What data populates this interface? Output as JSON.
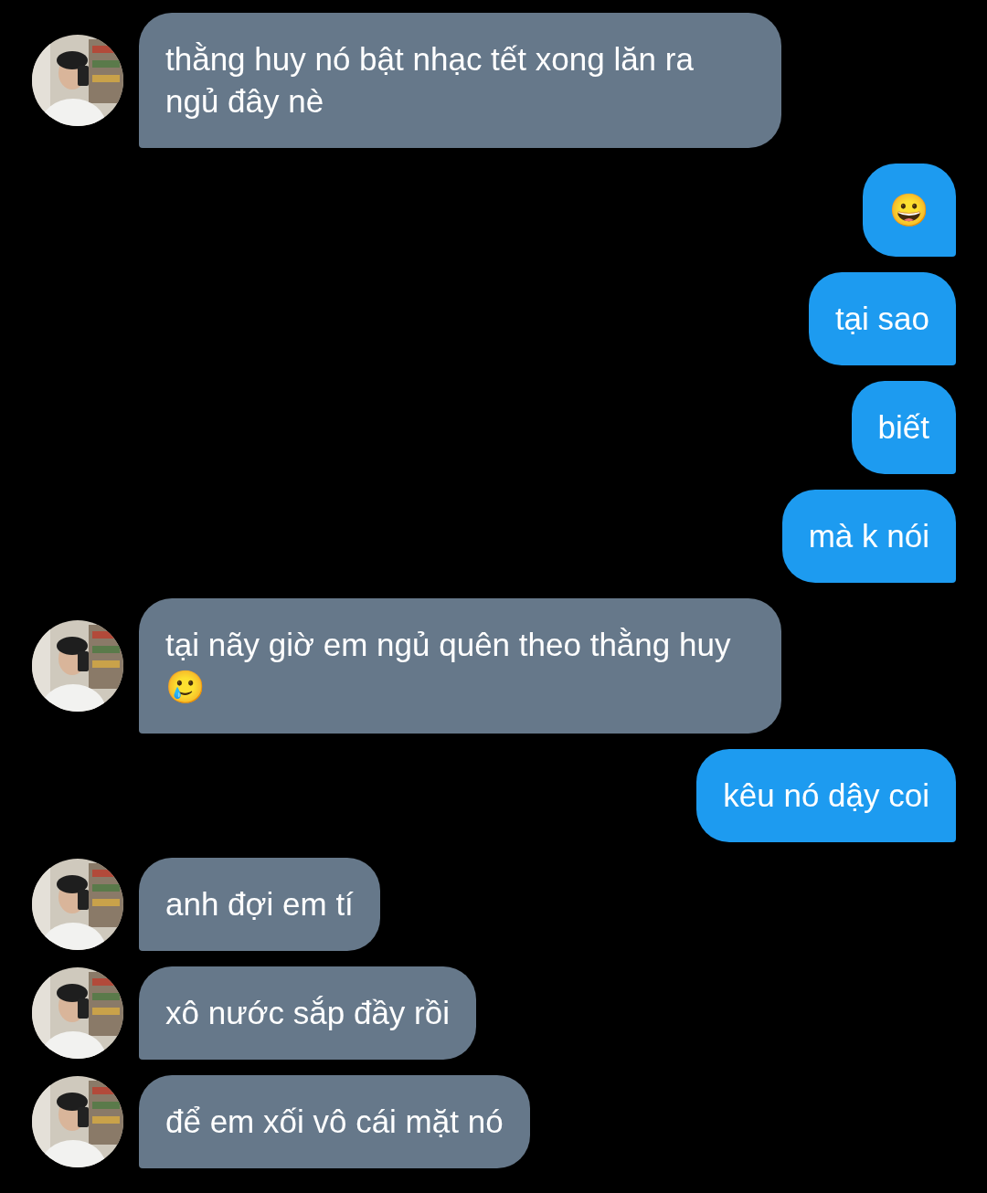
{
  "messages": [
    {
      "kind": "incoming",
      "text": "thằng huy nó bật nhạc tết xong lăn ra ngủ đây nè"
    },
    {
      "kind": "outgoing",
      "text": "😀"
    },
    {
      "kind": "outgoing",
      "text": "tại sao"
    },
    {
      "kind": "outgoing",
      "text": "biết"
    },
    {
      "kind": "outgoing",
      "text": "mà k nói"
    },
    {
      "kind": "incoming",
      "text": "tại nãy giờ em ngủ quên theo thằng huy 🥲"
    },
    {
      "kind": "outgoing",
      "text": "kêu nó dậy coi"
    },
    {
      "kind": "incoming",
      "text": "anh đợi em tí"
    },
    {
      "kind": "incoming",
      "text": "xô nước sắp đầy rồi"
    },
    {
      "kind": "incoming",
      "text": "để em xối vô cái mặt nó"
    }
  ]
}
